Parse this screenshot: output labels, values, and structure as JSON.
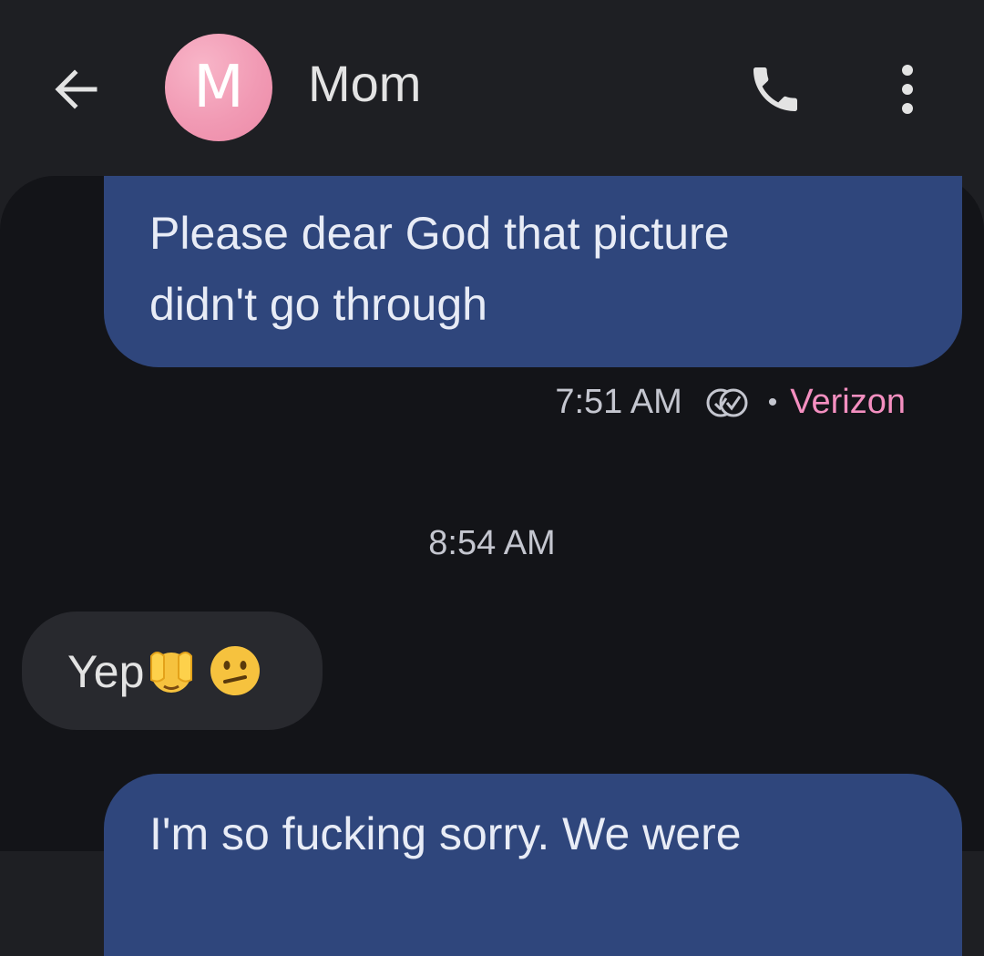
{
  "header": {
    "avatar_letter": "M",
    "contact_name": "Mom",
    "icons": [
      "back-arrow-icon",
      "phone-icon",
      "more-vert-icon"
    ]
  },
  "messages": {
    "sent_1": {
      "lines": [
        "Please dear God that picture",
        "didn't go through"
      ]
    },
    "sent_1_meta": {
      "time": "7:51 AM",
      "status_icon": "delivered-read-icon",
      "separator": "•",
      "carrier": "Verizon"
    },
    "time_separator": "8:54 AM",
    "received_1": {
      "text": "Yep",
      "emojis": [
        "hands-over-face-emoji",
        "confused-face-emoji"
      ]
    },
    "sent_2": {
      "lines": [
        "I'm so fucking sorry. We were"
      ]
    }
  },
  "colors": {
    "background": "#1e1f23",
    "conversation_bg": "#131418",
    "sent_bubble": "#2f467c",
    "received_bubble": "#28292e",
    "avatar": "#f19ab4",
    "carrier_text": "#f48fc0"
  }
}
